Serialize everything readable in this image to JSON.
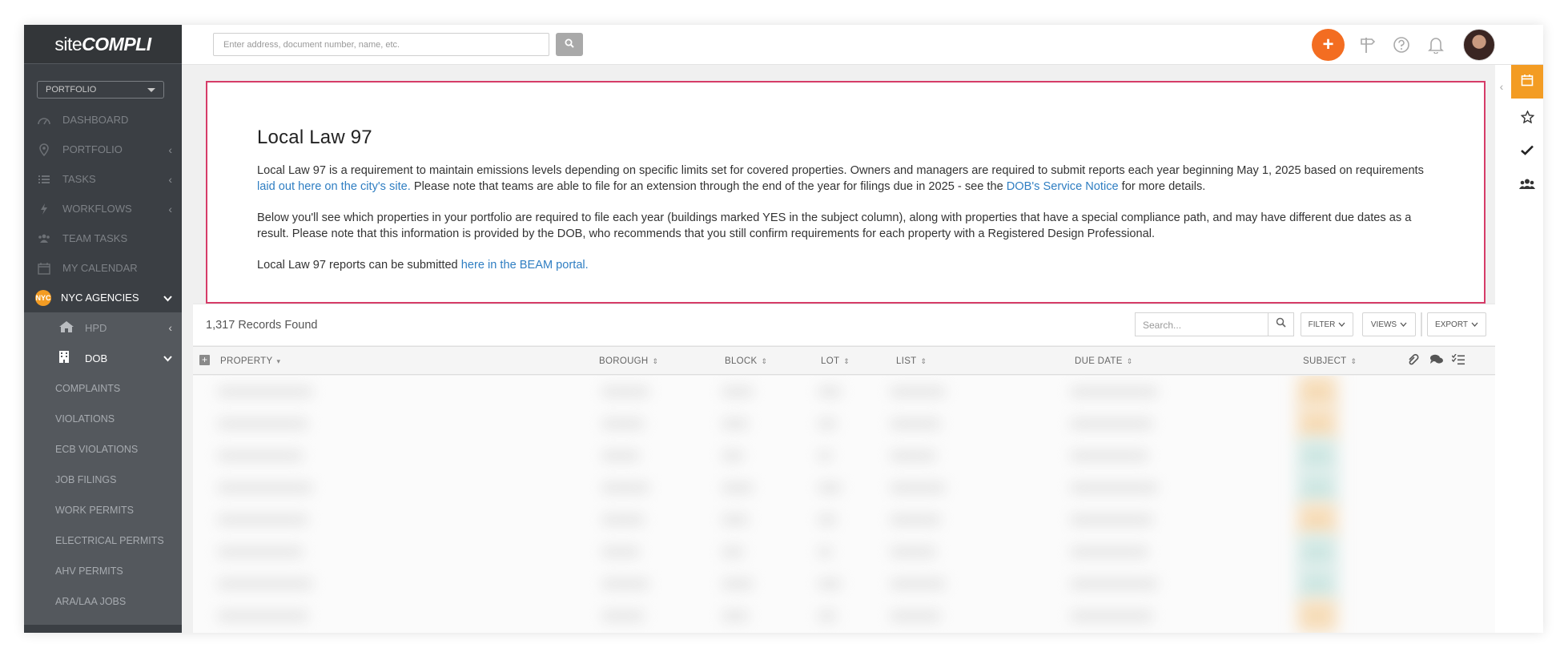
{
  "app": {
    "logo_thin": "site",
    "logo_bold": "COMPLI"
  },
  "sidebar": {
    "portfolio_select": "PORTFOLIO",
    "items": [
      {
        "label": "DASHBOARD",
        "icon": "dashboard-icon"
      },
      {
        "label": "PORTFOLIO",
        "icon": "location-pin-icon"
      },
      {
        "label": "TASKS",
        "icon": "list-icon"
      },
      {
        "label": "WORKFLOWS",
        "icon": "bolt-icon"
      },
      {
        "label": "TEAM TASKS",
        "icon": "team-icon"
      },
      {
        "label": "MY CALENDAR",
        "icon": "calendar-icon"
      },
      {
        "label": "NYC AGENCIES",
        "icon": "nyc-badge-icon",
        "badge": "NYC"
      }
    ],
    "agencies": [
      {
        "label": "HPD",
        "icon": "home-icon"
      },
      {
        "label": "DOB",
        "icon": "building-icon"
      }
    ],
    "dob_items": [
      "COMPLAINTS",
      "VIOLATIONS",
      "ECB VIOLATIONS",
      "JOB FILINGS",
      "WORK PERMITS",
      "ELECTRICAL PERMITS",
      "AHV PERMITS",
      "ARA/LAA JOBS"
    ]
  },
  "topbar": {
    "search_placeholder": "Enter address, document number, name, etc.",
    "plus_label": "+"
  },
  "info": {
    "title": "Local Law 97",
    "p1_a": "Local Law 97 is a requirement to maintain emissions levels depending on specific limits set for covered properties. Owners and managers are required to submit reports each year beginning May 1, 2025 based on requirements ",
    "p1_link1": "laid out here on the city's site.",
    "p1_b": "  Please note that teams are able to file for an extension through the end of the year for filings due in 2025 - see the ",
    "p1_link2": "DOB's Service Notice",
    "p1_c": " for more details.",
    "p2": "Below you'll see which properties in your portfolio are required to file each year (buildings marked YES in the subject column), along with properties that have a special compliance path, and may have different due dates as a result. Please note that this information is provided by the DOB, who recommends that you still confirm requirements for each property with a Registered Design Professional.",
    "p3_a": "Local Law 97 reports can be submitted ",
    "p3_link": "here in the BEAM portal."
  },
  "table": {
    "records": "1,317 Records Found",
    "search_placeholder": "Search...",
    "filter_label": "FILTER",
    "views_label": "VIEWS",
    "export_label": "EXPORT",
    "columns": [
      "PROPERTY",
      "BOROUGH",
      "BLOCK",
      "LOT",
      "LIST",
      "DUE DATE",
      "SUBJECT"
    ]
  },
  "colors": {
    "accent_orange": "#f36d21",
    "calendar_orange": "#f39c23",
    "info_border": "#d63c68",
    "link": "#2f7ec2",
    "sidebar_bg": "#3b3f44"
  }
}
